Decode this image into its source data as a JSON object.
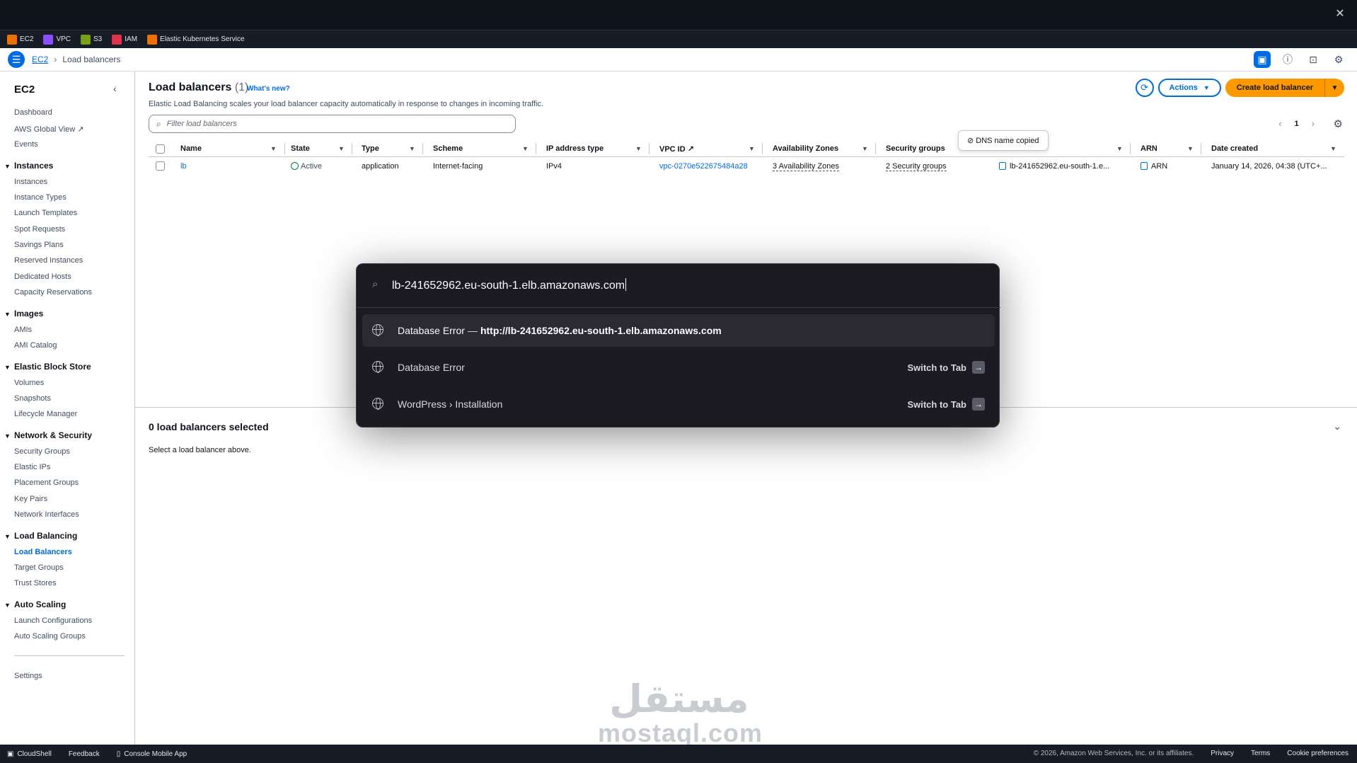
{
  "favorites": [
    {
      "label": "EC2",
      "color": "#ed7100"
    },
    {
      "label": "VPC",
      "color": "#8c4fff"
    },
    {
      "label": "S3",
      "color": "#7aa116"
    },
    {
      "label": "IAM",
      "color": "#dd344c"
    },
    {
      "label": "Elastic Kubernetes Service",
      "color": "#ed7100"
    }
  ],
  "breadcrumb": {
    "service": "EC2",
    "current": "Load balancers"
  },
  "sidebar": {
    "title": "EC2",
    "top_items": [
      "Dashboard",
      "AWS Global View",
      "Events"
    ],
    "sections": [
      {
        "heading": "Instances",
        "items": [
          "Instances",
          "Instance Types",
          "Launch Templates",
          "Spot Requests",
          "Savings Plans",
          "Reserved Instances",
          "Dedicated Hosts",
          "Capacity Reservations"
        ]
      },
      {
        "heading": "Images",
        "items": [
          "AMIs",
          "AMI Catalog"
        ]
      },
      {
        "heading": "Elastic Block Store",
        "items": [
          "Volumes",
          "Snapshots",
          "Lifecycle Manager"
        ]
      },
      {
        "heading": "Network & Security",
        "items": [
          "Security Groups",
          "Elastic IPs",
          "Placement Groups",
          "Key Pairs",
          "Network Interfaces"
        ]
      },
      {
        "heading": "Load Balancing",
        "items": [
          "Load Balancers",
          "Target Groups",
          "Trust Stores"
        ]
      },
      {
        "heading": "Auto Scaling",
        "items": [
          "Launch Configurations",
          "Auto Scaling Groups"
        ]
      }
    ],
    "settings": "Settings",
    "active_item": "Load Balancers"
  },
  "main": {
    "title": "Load balancers",
    "count": "(1)",
    "whats_new": "What's new?",
    "description": "Elastic Load Balancing scales your load balancer capacity automatically in response to changes in incoming traffic.",
    "filter_placeholder": "Filter load balancers",
    "actions_label": "Actions",
    "create_label": "Create load balancer",
    "page": "1"
  },
  "table": {
    "columns": [
      "Name",
      "State",
      "Type",
      "Scheme",
      "IP address type",
      "VPC ID",
      "Availability Zones",
      "Security groups",
      "",
      "ARN",
      "Date created"
    ],
    "row": {
      "name": "lb",
      "state": "Active",
      "type": "application",
      "scheme": "Internet-facing",
      "ip_type": "IPv4",
      "vpc_id": "vpc-0270e522675484a28",
      "azs": "3 Availability Zones",
      "security_groups": "2 Security groups",
      "dns": "lb-241652962.eu-south-1.e...",
      "arn": "ARN",
      "date": "January 14, 2026, 04:38 (UTC+..."
    },
    "tooltip": "DNS name copied"
  },
  "split_panel": {
    "title": "0 load balancers selected",
    "subtitle": "Select a load balancer above."
  },
  "address_bar": {
    "query": "lb-241652962.eu-south-1.elb.amazonaws.com",
    "suggestions": [
      {
        "title": "Database Error",
        "separator": "—",
        "url": "http://lb-241652962.eu-south-1.elb.amazonaws.com",
        "action": ""
      },
      {
        "title": "Database Error",
        "separator": "",
        "url": "",
        "action": "Switch to Tab"
      },
      {
        "title": "WordPress › Installation",
        "separator": "",
        "url": "",
        "action": "Switch to Tab"
      }
    ]
  },
  "watermark": {
    "arabic": "مستقل",
    "latin": "mostaql.com"
  },
  "footer": {
    "left": [
      "CloudShell",
      "Feedback",
      "Console Mobile App"
    ],
    "copyright": "© 2026, Amazon Web Services, Inc. or its affiliates.",
    "links": [
      "Privacy",
      "Terms",
      "Cookie preferences"
    ]
  }
}
